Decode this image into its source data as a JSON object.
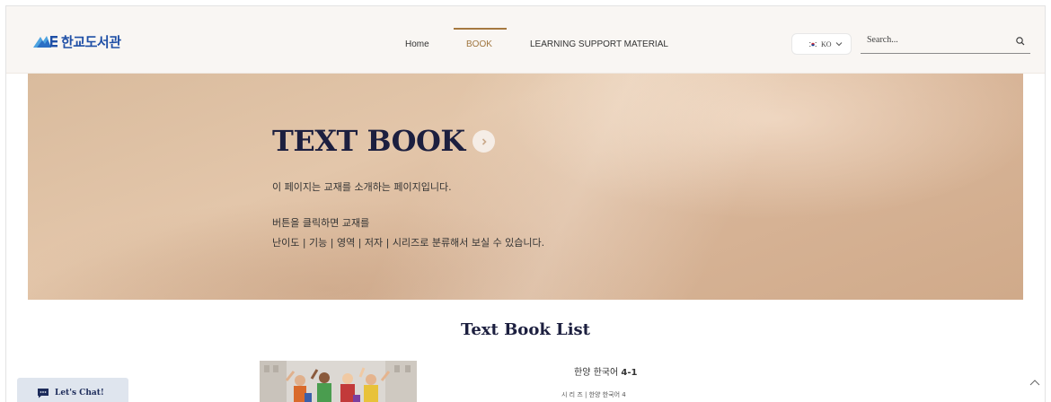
{
  "header": {
    "logo_text": "한교도서관",
    "nav": [
      {
        "label": "Home",
        "active": false
      },
      {
        "label": "BOOK",
        "active": true
      },
      {
        "label": "LEARNING SUPPORT MATERIAL",
        "active": false
      }
    ],
    "language": {
      "code": "KO",
      "flag": "korea-flag-icon"
    },
    "search": {
      "placeholder": "Search...",
      "value": ""
    }
  },
  "hero": {
    "title": "TEXT BOOK",
    "line1": "이 페이지는 교재를 소개하는 페이지입니다.",
    "line2": "버튼을 클릭하면 교재를",
    "line3": "난이도 | 기능 | 영역 | 저자 | 시리즈로 분류해서 보실 수 있습니다."
  },
  "list": {
    "title": "Text Book List",
    "books": [
      {
        "name_prefix": "한양 한국어 ",
        "name_bold": "4-1",
        "series": "시 리 즈 | 한양 한국어 4"
      }
    ]
  },
  "chat": {
    "label": "Let's Chat!"
  },
  "colors": {
    "accent": "#a67940",
    "hero_title": "#1c1f3f",
    "logo": "#1f4fa6",
    "header_bg": "#f9f6f3"
  }
}
